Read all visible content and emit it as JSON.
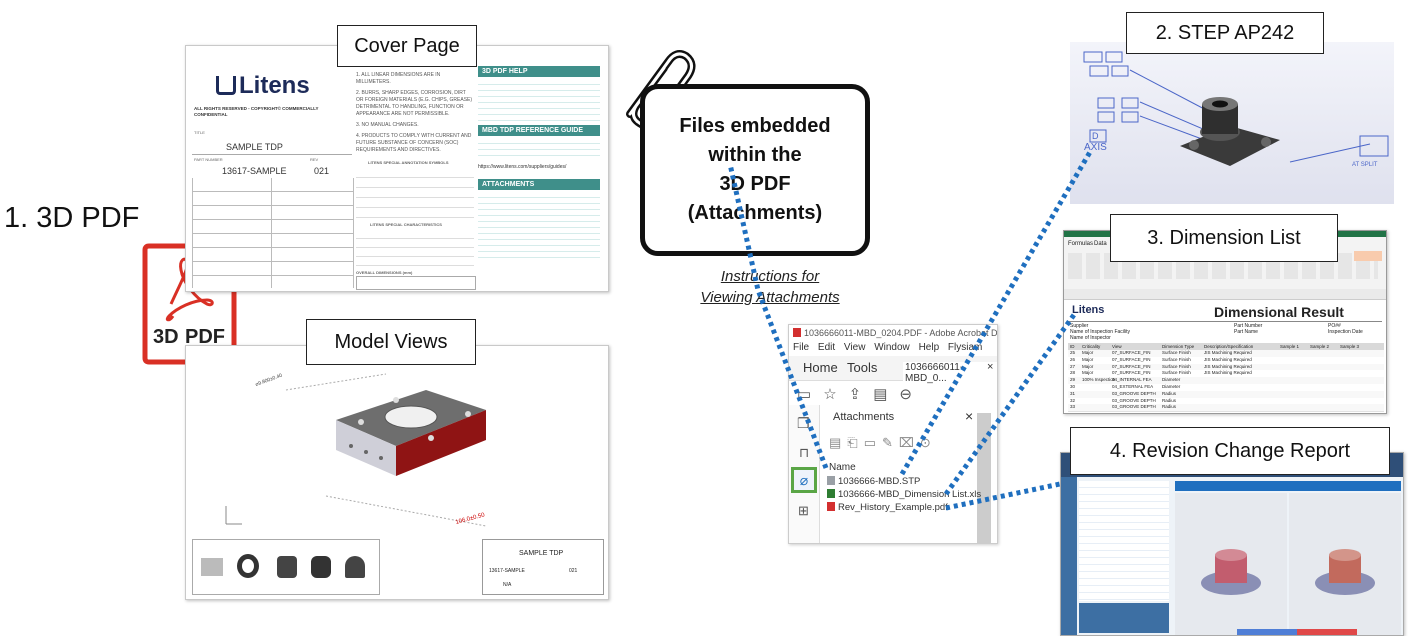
{
  "step_title": "1. 3D PDF",
  "callouts": {
    "cover_page": "Cover Page",
    "model_views": "Model Views",
    "step": "2. STEP AP242",
    "dimension_list": "3. Dimension List",
    "revision_report": "4. Revision Change Report"
  },
  "embedded_box": {
    "line1": "Files embedded",
    "line2": "within the",
    "line3": "3D PDF",
    "line4": "(Attachments)"
  },
  "instructions_link": {
    "line1": "Instructions for",
    "line2": "Viewing Attachments"
  },
  "pdf_badge": {
    "top_label": "3D",
    "bottom_label": "PDF"
  },
  "cover": {
    "logo": "Litens",
    "rights": "ALL RIGHTS RESERVED - COPYRIGHT© COMMERCIALLY CONFIDENTIAL",
    "title_label": "TITLE",
    "title": "SAMPLE TDP",
    "part_number_label": "PART NUMBER",
    "part_number": "13617-SAMPLE",
    "rev_label": "REV",
    "rev": "021",
    "notes": [
      "1. ALL LINEAR DIMENSIONS ARE IN MILLIMETERS.",
      "2. BURRS, SHARP EDGES, CORROSION, DIRT OR FOREIGN MATERIALS (E.G. CHIPS, GREASE) DETRIMENTAL TO HANDLING, FUNCTION OR APPEARANCE ARE NOT PERMISSIBLE.",
      "3. NO MANUAL CHANGES.",
      "4. PRODUCTS TO COMPLY WITH CURRENT AND FUTURE SUBSTANCE OF CONCERN (SOC) REQUIREMENTS AND DIRECTIVES."
    ],
    "symbols_header": "LITENS SPECIAL ANNOTATION SYMBOLS",
    "characteristics_header": "LITENS SPECIAL CHARACTERISTICS",
    "overall_dims": "OVERALL DIMENSIONS (mm)",
    "help_header": "3D PDF HELP",
    "mbd_header": "MBD TDP REFERENCE GUIDE",
    "url": "https://www.litens.com/suppliers/guides/",
    "attachments_header": "ATTACHMENTS"
  },
  "model_sheet": {
    "title": "SAMPLE TDP",
    "part_number": "13617-SAMPLE",
    "rev": "021",
    "status": "N/A"
  },
  "acrobat": {
    "window_title": "1036666011-MBD_0204.PDF - Adobe Acrobat DC",
    "menu": [
      "File",
      "Edit",
      "View",
      "Window",
      "Help",
      "Flysiam"
    ],
    "tabs": [
      "Home",
      "Tools"
    ],
    "doc_tab": "1036666011-MBD_0...",
    "close": "×",
    "panel_title": "Attachments",
    "column_name": "Name",
    "files": [
      {
        "name": "1036666-MBD.STP",
        "color": "#9aa0a6"
      },
      {
        "name": "1036666-MBD_Dimension List.xls",
        "color": "#2e7d32"
      },
      {
        "name": "Rev_History_Example.pdf",
        "color": "#d32f2f"
      }
    ]
  },
  "step_model": {
    "labels": [
      "D",
      "AXIS",
      "AT SPLIT"
    ]
  },
  "excel": {
    "menu": [
      "Formulas",
      "Data"
    ],
    "logo": "Litens",
    "title": "Dimensional Result",
    "header_left": [
      "Supplier",
      "Name of Inspection Facility",
      "Name of Inspector"
    ],
    "header_mid": [
      "Part Number",
      "Part Name"
    ],
    "header_right": [
      "PO##",
      "Inspection Date"
    ],
    "columns": [
      "ID",
      "Criticality",
      "View",
      "Dimension Type",
      "Description/Specification",
      "Sample 1",
      "Sample 2",
      "Sample 3"
    ],
    "rows": [
      [
        "25",
        "Major",
        "07_SURFACE_FIN",
        "Surface Finish",
        "JIS Machining Required"
      ],
      [
        "26",
        "Major",
        "07_SURFACE_FIN",
        "Surface Finish",
        "JIS Machining Required"
      ],
      [
        "27",
        "Major",
        "07_SURFACE_FIN",
        "Surface Finish",
        "JIS Machining Required"
      ],
      [
        "28",
        "Major",
        "07_SURFACE_FIN",
        "Surface Finish",
        "JIS Machining Required"
      ],
      [
        "29",
        "100% Inspection",
        "04_INTERNAL FEA",
        "Diameter",
        ""
      ],
      [
        "30",
        "",
        "04_EXTERNAL FEA",
        "Diameter",
        ""
      ],
      [
        "31",
        "",
        "03_GROOVE DEPTH",
        "Radius",
        ""
      ],
      [
        "32",
        "",
        "03_GROOVE DEPTH",
        "Radius",
        ""
      ],
      [
        "33",
        "",
        "03_GROOVE DEPTH",
        "Radius",
        ""
      ]
    ]
  },
  "colors": {
    "accent_blue": "#1f6fbf",
    "green_header": "#3f8f8a",
    "acrobat_red": "#d32f2f",
    "attachment_highlight": "#5aa646"
  }
}
